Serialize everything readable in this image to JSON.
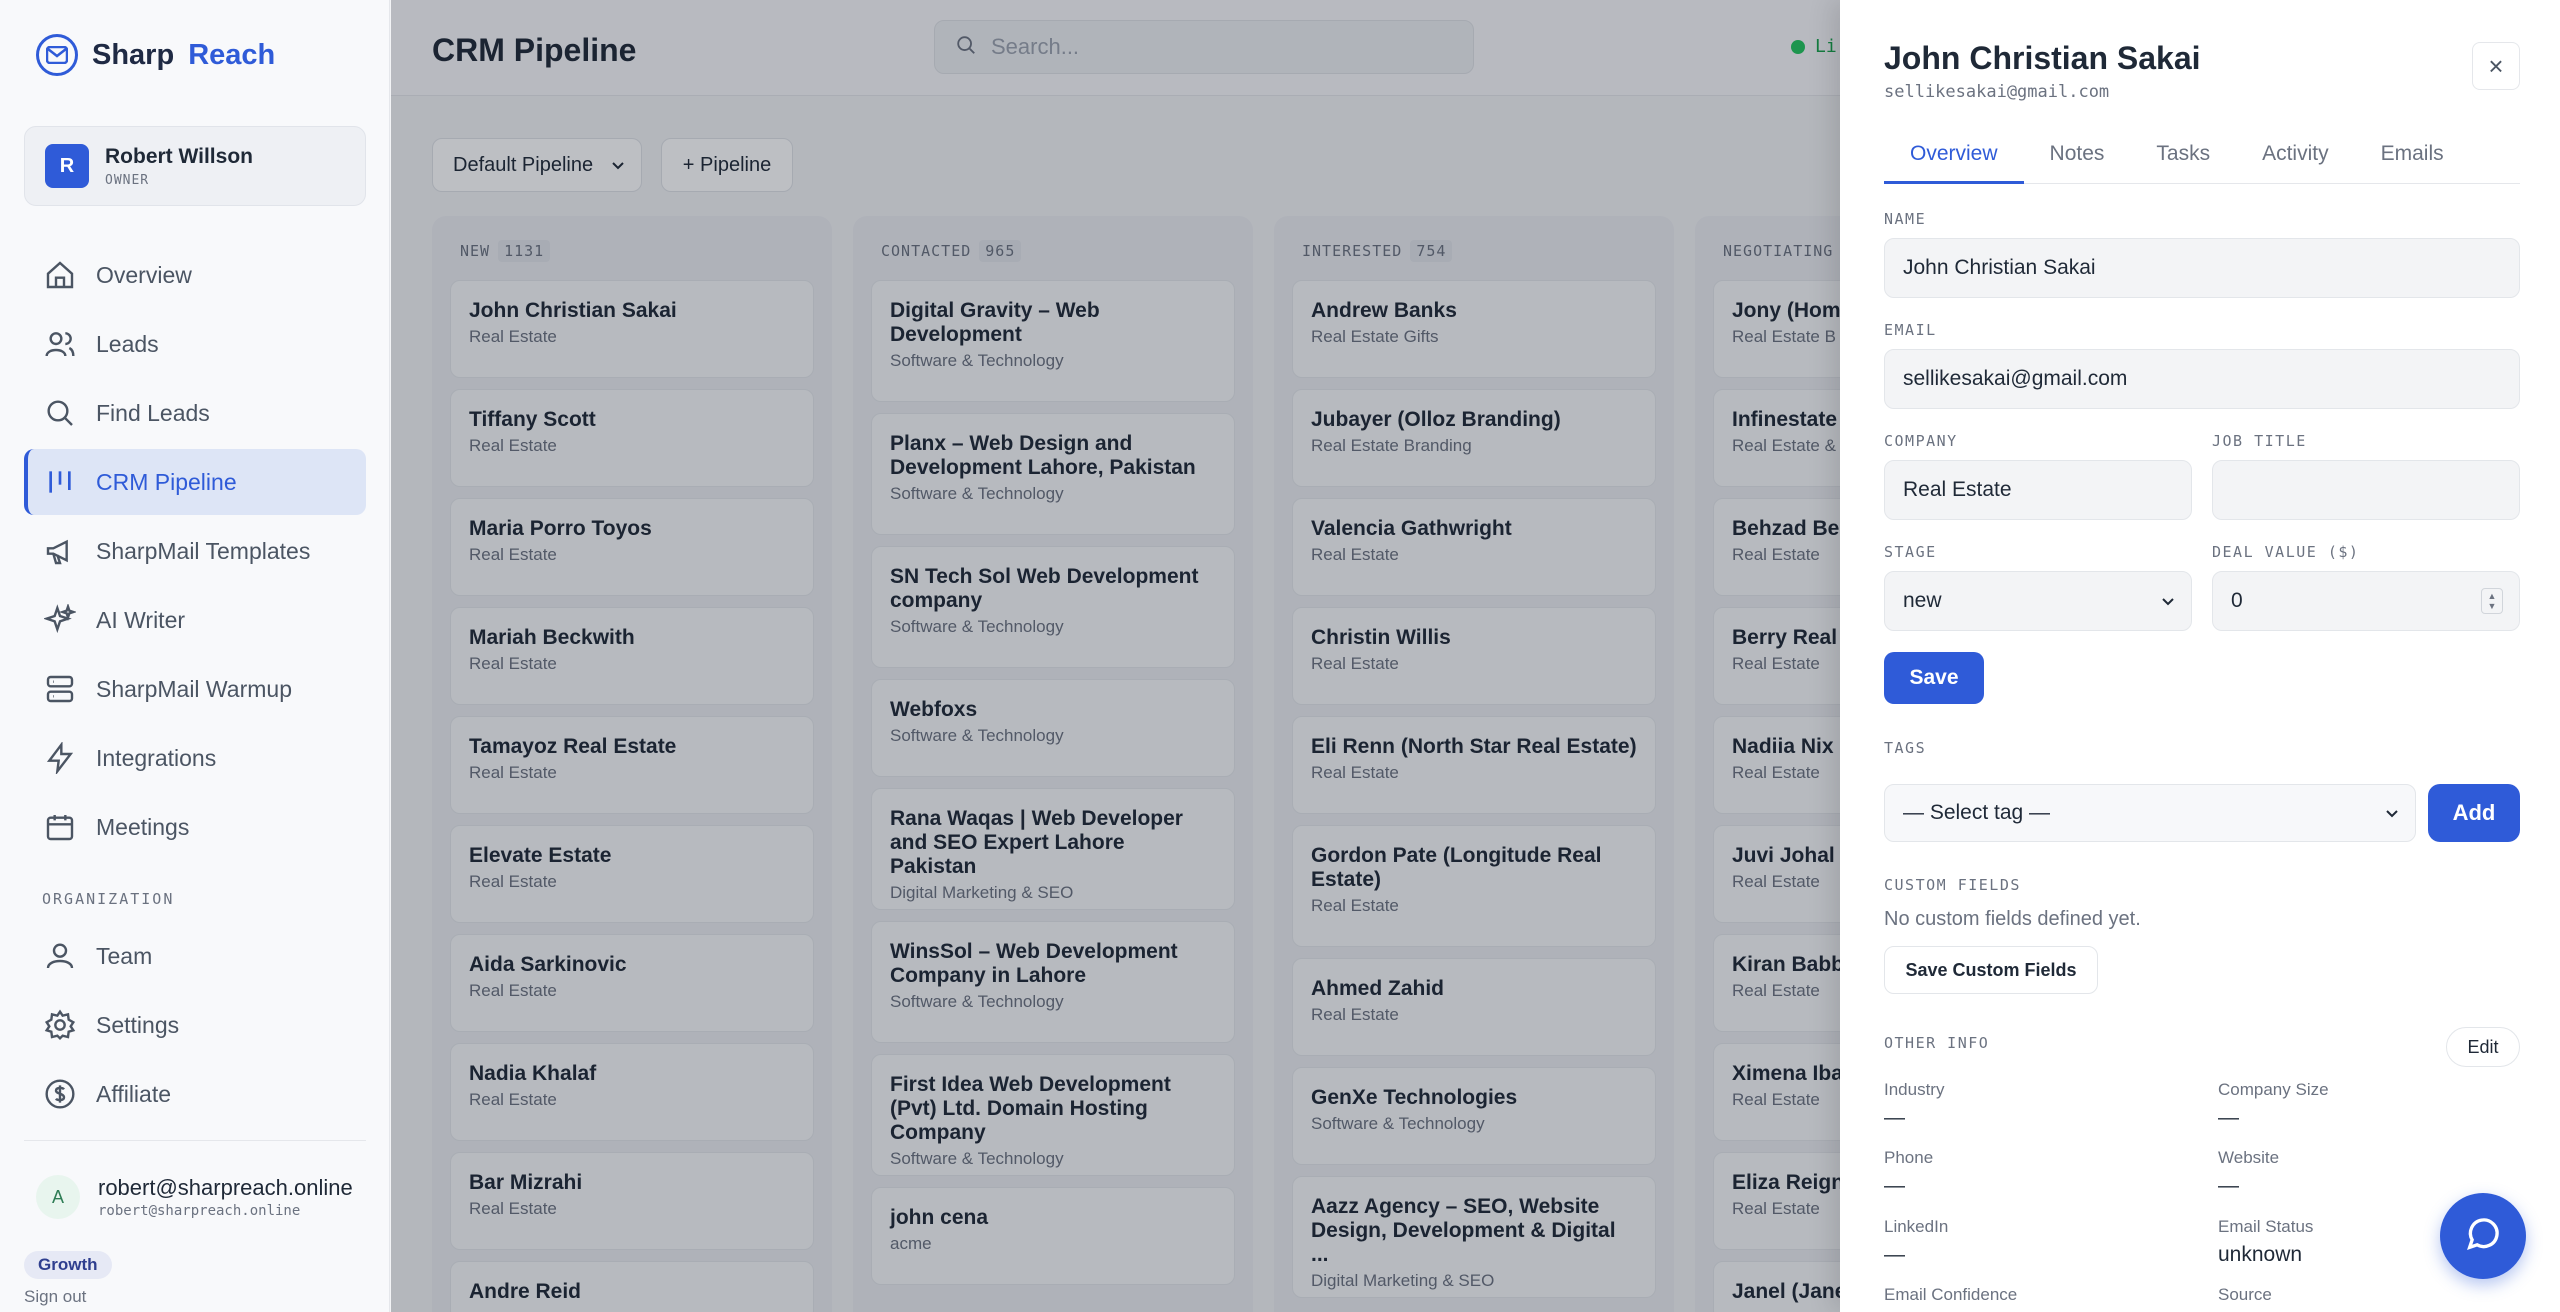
{
  "brand": {
    "name": "Sharp",
    "accent": "Reach",
    "color": "#2f5bd8"
  },
  "user": {
    "initial": "R",
    "name": "Robert Willson",
    "role": "OWNER"
  },
  "nav": [
    {
      "label": "Overview",
      "icon": "home-icon"
    },
    {
      "label": "Leads",
      "icon": "users-icon"
    },
    {
      "label": "Find Leads",
      "icon": "search-icon"
    },
    {
      "label": "CRM Pipeline",
      "icon": "pipeline-icon",
      "active": true
    },
    {
      "label": "SharpMail Templates",
      "icon": "megaphone-icon"
    },
    {
      "label": "AI Writer",
      "icon": "sparkles-icon"
    },
    {
      "label": "SharpMail Warmup",
      "icon": "server-icon"
    },
    {
      "label": "Integrations",
      "icon": "bolt-icon"
    },
    {
      "label": "Meetings",
      "icon": "calendar-icon"
    }
  ],
  "org_section": "ORGANIZATION",
  "org_nav": [
    {
      "label": "Team",
      "icon": "user-icon"
    },
    {
      "label": "Settings",
      "icon": "gear-icon"
    },
    {
      "label": "Affiliate",
      "icon": "dollar-icon"
    }
  ],
  "account": {
    "initial": "A",
    "email": "robert@sharpreach.online",
    "email_mono": "robert@sharpreach.online",
    "plan": "Growth",
    "signout": "Sign out"
  },
  "header": {
    "title": "CRM Pipeline",
    "search_placeholder": "Search...",
    "live": "Li"
  },
  "toolbar": {
    "pipeline": "Default Pipeline",
    "add_pipeline": "+ Pipeline"
  },
  "columns": [
    {
      "name": "NEW",
      "count": "1131",
      "cards": [
        {
          "title": "John Christian Sakai",
          "sub": "Real Estate"
        },
        {
          "title": "Tiffany Scott",
          "sub": "Real Estate"
        },
        {
          "title": "Maria Porro Toyos",
          "sub": "Real Estate"
        },
        {
          "title": "Mariah Beckwith",
          "sub": "Real Estate"
        },
        {
          "title": "Tamayoz Real Estate",
          "sub": "Real Estate"
        },
        {
          "title": "Elevate Estate",
          "sub": "Real Estate"
        },
        {
          "title": "Aida Sarkinovic",
          "sub": "Real Estate"
        },
        {
          "title": "Nadia Khalaf",
          "sub": "Real Estate"
        },
        {
          "title": "Bar Mizrahi",
          "sub": "Real Estate"
        },
        {
          "title": "Andre Reid",
          "sub": ""
        }
      ]
    },
    {
      "name": "CONTACTED",
      "count": "965",
      "cards": [
        {
          "title": "Digital Gravity – Web Development",
          "sub": "Software & Technology"
        },
        {
          "title": "Planx – Web Design and Development Lahore, Pakistan",
          "sub": "Software & Technology"
        },
        {
          "title": "SN Tech Sol Web Development company",
          "sub": "Software & Technology"
        },
        {
          "title": "Webfoxs",
          "sub": "Software & Technology"
        },
        {
          "title": "Rana Waqas | Web Developer and SEO Expert Lahore Pakistan",
          "sub": "Digital Marketing & SEO"
        },
        {
          "title": "WinsSol – Web Development Company in Lahore",
          "sub": "Software & Technology"
        },
        {
          "title": "First Idea Web Development (Pvt) Ltd. Domain Hosting Company",
          "sub": "Software & Technology"
        },
        {
          "title": "john cena",
          "sub": "acme"
        }
      ]
    },
    {
      "name": "INTERESTED",
      "count": "754",
      "cards": [
        {
          "title": "Andrew Banks",
          "sub": "Real Estate Gifts"
        },
        {
          "title": "Jubayer (Olloz Branding)",
          "sub": "Real Estate Branding"
        },
        {
          "title": "Valencia Gathwright",
          "sub": "Real Estate"
        },
        {
          "title": "Christin Willis",
          "sub": "Real Estate"
        },
        {
          "title": "Eli Renn (North Star Real Estate)",
          "sub": "Real Estate"
        },
        {
          "title": "Gordon Pate (Longitude Real Estate)",
          "sub": "Real Estate"
        },
        {
          "title": "Ahmed Zahid",
          "sub": "Real Estate"
        },
        {
          "title": "GenXe Technologies",
          "sub": "Software & Technology"
        },
        {
          "title": "Aazz Agency – SEO, Website Design, Development & Digital ...",
          "sub": "Digital Marketing & SEO"
        }
      ]
    },
    {
      "name": "NEGOTIATING",
      "count": "",
      "cards": [
        {
          "title": "Jony (Home",
          "sub": "Real Estate B"
        },
        {
          "title": "Infinestate",
          "sub": "Real Estate &"
        },
        {
          "title": "Behzad Beh",
          "sub": "Real Estate"
        },
        {
          "title": "Berry Real E",
          "sub": "Real Estate"
        },
        {
          "title": "Nadiia Nix",
          "sub": "Real Estate"
        },
        {
          "title": "Juvi Johal",
          "sub": "Real Estate"
        },
        {
          "title": "Kiran Babba",
          "sub": "Real Estate"
        },
        {
          "title": "Ximena Ibar",
          "sub": "Real Estate"
        },
        {
          "title": "Eliza Reign",
          "sub": "Real Estate"
        },
        {
          "title": "Janel (Janel",
          "sub": ""
        }
      ]
    }
  ],
  "drawer": {
    "name": "John Christian Sakai",
    "email": "sellikesakai@gmail.com",
    "tabs": [
      "Overview",
      "Notes",
      "Tasks",
      "Activity",
      "Emails"
    ],
    "labels": {
      "name": "NAME",
      "email": "EMAIL",
      "company": "COMPANY",
      "job_title": "JOB TITLE",
      "stage": "STAGE",
      "deal_value": "DEAL VALUE ($)",
      "tags": "TAGS",
      "custom_fields": "CUSTOM FIELDS",
      "other_info": "OTHER INFO"
    },
    "values": {
      "name": "John Christian Sakai",
      "email": "sellikesakai@gmail.com",
      "company": "Real Estate",
      "job_title": "",
      "stage": "new",
      "deal_value": "0"
    },
    "save": "Save",
    "tag_select": "— Select tag —",
    "add": "Add",
    "no_custom": "No custom fields defined yet.",
    "save_custom": "Save Custom Fields",
    "edit": "Edit",
    "info": [
      {
        "k": "Industry",
        "v": "—"
      },
      {
        "k": "Company Size",
        "v": "—"
      },
      {
        "k": "Phone",
        "v": "—"
      },
      {
        "k": "Website",
        "v": "—"
      },
      {
        "k": "LinkedIn",
        "v": "—"
      },
      {
        "k": "Email Status",
        "v": "unknown"
      },
      {
        "k": "Email Confidence",
        "v": ""
      },
      {
        "k": "Source",
        "v": ""
      }
    ]
  }
}
